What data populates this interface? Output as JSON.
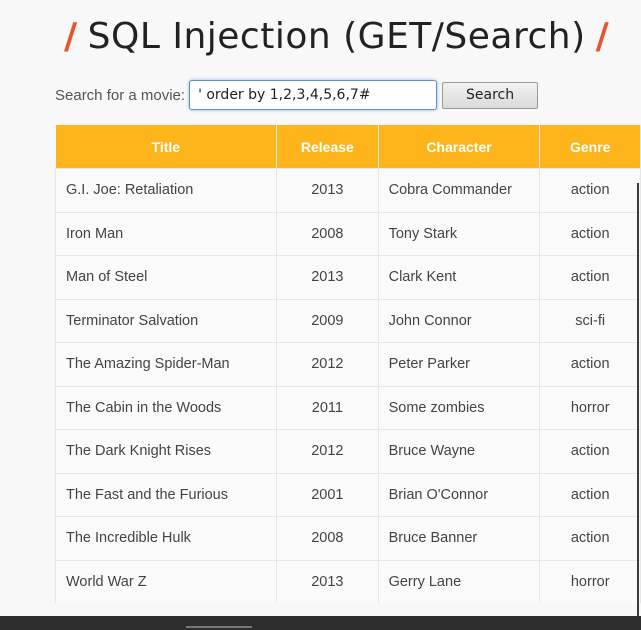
{
  "page": {
    "title": "SQL Injection (GET/Search)",
    "title_slash": "/"
  },
  "search": {
    "label": "Search for a movie:",
    "value": "' order by 1,2,3,4,5,6,7#",
    "button_label": "Search"
  },
  "table": {
    "headers": [
      "Title",
      "Release",
      "Character",
      "Genre"
    ],
    "rows": [
      [
        "G.I. Joe: Retaliation",
        "2013",
        "Cobra Commander",
        "action"
      ],
      [
        "Iron Man",
        "2008",
        "Tony Stark",
        "action"
      ],
      [
        "Man of Steel",
        "2013",
        "Clark Kent",
        "action"
      ],
      [
        "Terminator Salvation",
        "2009",
        "John Connor",
        "sci-fi"
      ],
      [
        "The Amazing Spider-Man",
        "2012",
        "Peter Parker",
        "action"
      ],
      [
        "The Cabin in the Woods",
        "2011",
        "Some zombies",
        "horror"
      ],
      [
        "The Dark Knight Rises",
        "2012",
        "Bruce Wayne",
        "action"
      ],
      [
        "The Fast and the Furious",
        "2001",
        "Brian O'Connor",
        "action"
      ],
      [
        "The Incredible Hulk",
        "2008",
        "Bruce Banner",
        "action"
      ],
      [
        "World War Z",
        "2013",
        "Gerry Lane",
        "horror"
      ]
    ]
  },
  "colors": {
    "header_bg": "#fdb51b",
    "accent_slash": "#e4572e"
  }
}
